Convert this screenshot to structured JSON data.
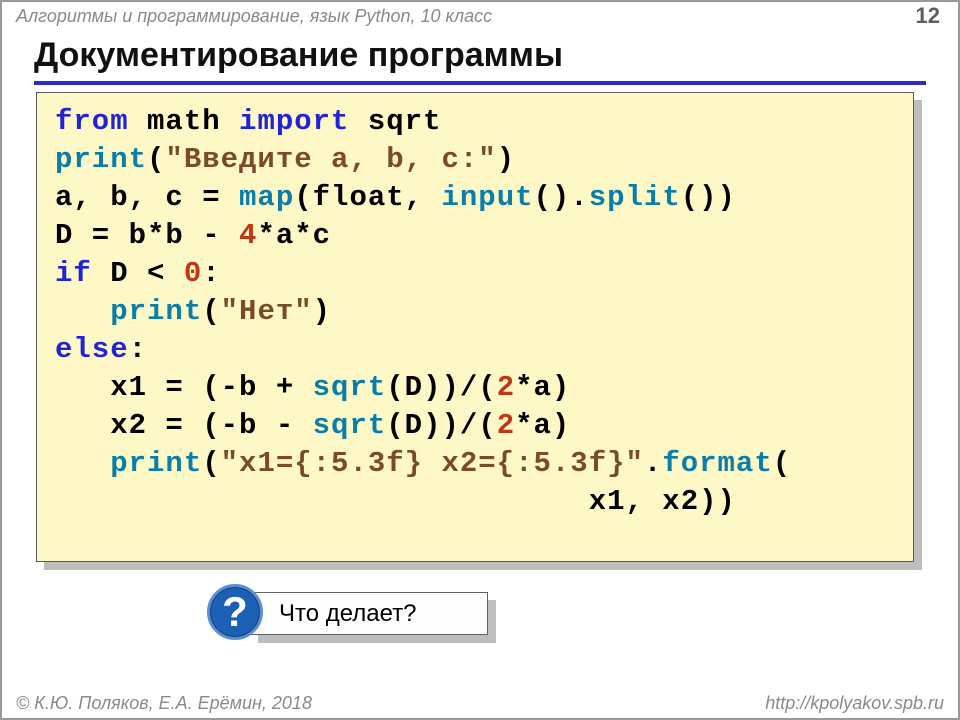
{
  "header": {
    "subject": "Алгоритмы и программирование, язык Python, 10 класс",
    "page": "12"
  },
  "title": "Документирование программы",
  "code": {
    "l1": {
      "a": "from",
      "b": " math ",
      "c": "import",
      "d": " sqrt"
    },
    "l2": {
      "a": "print",
      "b": "(",
      "c": "\"Введите a, b, c:\"",
      "d": ")"
    },
    "l3": {
      "a": "a, b, c = ",
      "b": "map",
      "c": "(float, ",
      "d": "input",
      "e": "().",
      "f": "split",
      "g": "())"
    },
    "l4": {
      "a": "D = b*b - ",
      "b": "4",
      "c": "*a*c"
    },
    "l5": {
      "a": "if",
      "b": " D < ",
      "c": "0",
      "d": ":"
    },
    "l6": {
      "pad": "   ",
      "a": "print",
      "b": "(",
      "c": "\"Нет\"",
      "d": ")"
    },
    "l7": {
      "a": "else",
      "b": ":"
    },
    "l8": {
      "pad": "   ",
      "a": "x1 = (-b + ",
      "b": "sqrt",
      "c": "(D))/(",
      "d": "2",
      "e": "*a)"
    },
    "l9": {
      "pad": "   ",
      "a": "x2 = (-b - ",
      "b": "sqrt",
      "c": "(D))/(",
      "d": "2",
      "e": "*a)"
    },
    "l10": {
      "pad": "   ",
      "a": "print",
      "b": "(",
      "c": "\"x1={:5.3f} x2={:5.3f}\"",
      "d": ".",
      "e": "format",
      "f": "("
    },
    "l11": {
      "pad": "                             ",
      "a": "x1, x2))"
    }
  },
  "question": {
    "mark": "?",
    "text": "Что делает?"
  },
  "footer": {
    "left": "© К.Ю. Поляков, Е.А. Ерёмин, 2018",
    "right": "http://kpolyakov.spb.ru"
  }
}
